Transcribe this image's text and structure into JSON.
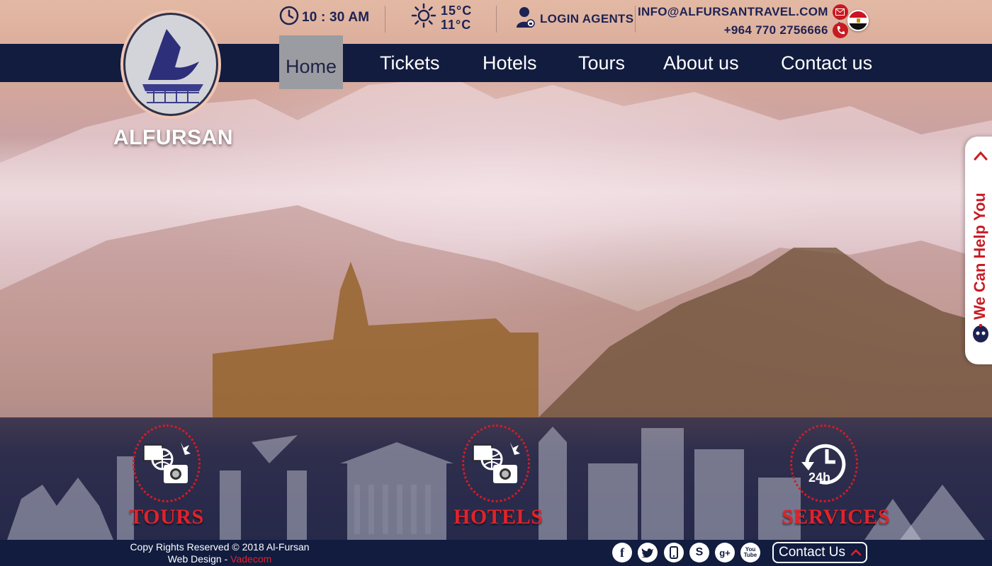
{
  "topbar": {
    "time": "10 : 30 AM",
    "temp_high": "15°C",
    "temp_low": "11°C",
    "login_label": "LOGIN AGENTS",
    "email": "INFO@ALFURSANTRAVEL.COM",
    "phone": "+964 770 2756666",
    "separator": ":"
  },
  "logo": {
    "name": "ALFURSAN"
  },
  "nav": {
    "items": [
      {
        "label": "Home",
        "active": true
      },
      {
        "label": "Tickets"
      },
      {
        "label": "Hotels"
      },
      {
        "label": "Tours"
      },
      {
        "label": "About us"
      },
      {
        "label": "Contact us"
      }
    ]
  },
  "help": {
    "label": "We Can Help You"
  },
  "features": [
    {
      "label": "TOURS",
      "icon": "camera-globe-icon"
    },
    {
      "label": "HOTELS",
      "icon": "camera-globe-icon"
    },
    {
      "label": "SERVICES",
      "icon": "24h-service-icon",
      "badge": "24h"
    }
  ],
  "footer": {
    "copyright": "Copy Rights Reserved © 2018 Al-Fursan",
    "design_prefix": "Web Design - ",
    "designer": "Vadecom",
    "contact_label": "Contact Us",
    "social": [
      {
        "name": "facebook-icon",
        "glyph": "f"
      },
      {
        "name": "twitter-icon",
        "glyph": "t"
      },
      {
        "name": "mobile-icon",
        "glyph": "▯"
      },
      {
        "name": "skype-icon",
        "glyph": "S"
      },
      {
        "name": "google-plus-icon",
        "glyph": "g+"
      },
      {
        "name": "youtube-icon",
        "glyph": "You\nTube"
      }
    ]
  },
  "colors": {
    "navy": "#111c3f",
    "accent_red": "#e0232a",
    "active_nav": "#9b9ca1"
  }
}
